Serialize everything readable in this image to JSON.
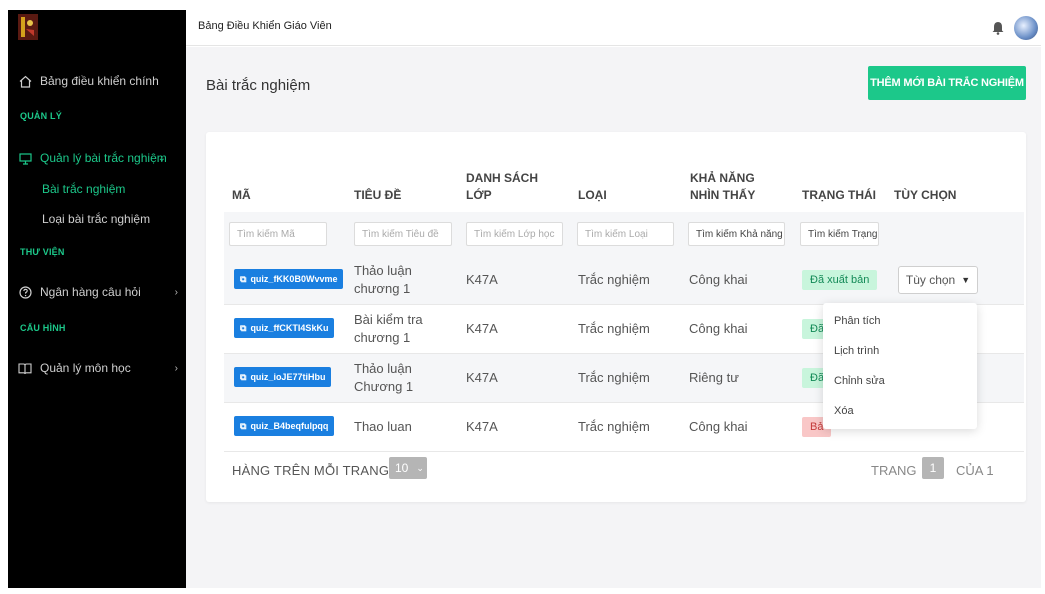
{
  "topbar": {
    "title": "Bảng Điều Khiển Giáo Viên"
  },
  "sidebar": {
    "dashboard": "Bảng điều khiển chính",
    "section_manage": "QUẢN LÝ",
    "quiz_manage": "Quản lý bài trắc nghiệm",
    "quiz_list": "Bài trắc nghiệm",
    "quiz_type": "Loại bài trắc nghiệm",
    "section_library": "THƯ VIỆN",
    "question_bank": "Ngân hàng câu hỏi",
    "section_config": "CẤU HÌNH",
    "subject_manage": "Quản lý môn học"
  },
  "page": {
    "title": "Bài trắc nghiệm",
    "add_button": "THÊM MỚI BÀI TRẮC NGHIỆM"
  },
  "table": {
    "headers": {
      "code": "MÃ",
      "title": "TIÊU ĐỀ",
      "class_list": "DANH SÁCH LỚP",
      "type": "LOẠI",
      "visibility": "KHẢ NĂNG NHÌN THẤY",
      "status": "TRẠNG THÁI",
      "options": "TÙY CHỌN"
    },
    "filters": {
      "code": "Tìm kiếm Mã",
      "title": "Tìm kiếm Tiêu đề",
      "class_list": "Tìm kiếm Lớp học",
      "type": "Tìm kiếm Loại",
      "visibility": "Tìm kiếm Khả năng",
      "status": "Tìm kiếm Trạng"
    },
    "rows": [
      {
        "code": "quiz_fKK0B0Wvvme",
        "title": "Thảo luận chương 1",
        "class_list": "K47A",
        "type": "Trắc nghiệm",
        "visibility": "Công khai",
        "status": "Đã xuất bản",
        "option": "Tùy chọn"
      },
      {
        "code": "quiz_ffCKTI4SkKu",
        "title": "Bài kiểm tra chương 1",
        "class_list": "K47A",
        "type": "Trắc nghiệm",
        "visibility": "Công khai",
        "status": "Đã"
      },
      {
        "code": "quiz_ioJE77tiHbu",
        "title": "Thảo luận Chương 1",
        "class_list": "K47A",
        "type": "Trắc nghiệm",
        "visibility": "Riêng tư",
        "status": "Đã"
      },
      {
        "code": "quiz_B4beqfulpqq",
        "title": "Thao luan",
        "class_list": "K47A",
        "type": "Trắc nghiệm",
        "visibility": "Công khai",
        "status": "Bả"
      }
    ]
  },
  "pagination": {
    "rows_per_page_label": "HÀNG TRÊN MỖI TRANG:",
    "rows_per_page": "10",
    "page_label": "TRANG",
    "current_page": "1",
    "of_label": "CỦA 1"
  },
  "dropdown": {
    "items": [
      "Phân tích",
      "Lịch trình",
      "Chỉnh sửa",
      "Xóa"
    ]
  },
  "colors": {
    "accent": "#1cc88a",
    "code_badge": "#1a7fe0",
    "published_bg": "#c8f5dc",
    "draft_bg": "#f9c7c7",
    "sidebar_bg": "#000000"
  }
}
